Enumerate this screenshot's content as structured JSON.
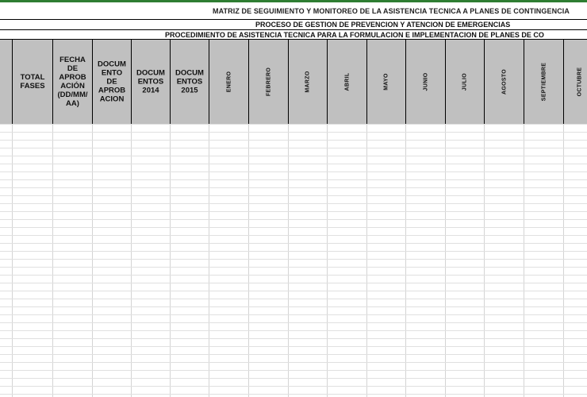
{
  "sheet": {
    "title": "MATRIZ DE SEGUIMIENTO Y MONITOREO DE LA ASISTENCIA TECNICA A PLANES DE CONTINGENCIA",
    "subtitle1": "PROCESO DE GESTION DE PREVENCION Y ATENCION DE EMERGENCIAS",
    "subtitle2": "PROCEDIMIENTO DE ASISTENCIA TECNICA PARA LA FORMULACION E IMPLEMENTACION DE PLANES DE CO"
  },
  "columns": [
    {
      "label": ""
    },
    {
      "label": "TOTAL\nFASES"
    },
    {
      "label": "FECHA\nDE\nAPROB\nACIÓN\n(DD/MM/\nAA)"
    },
    {
      "label": "DOCUM\nENTO\nDE\nAPROB\nACION"
    },
    {
      "label": "DOCUM\nENTOS\n2014"
    },
    {
      "label": "DOCUM\nENTOS\n2015"
    },
    {
      "label": "ENERO"
    },
    {
      "label": "FEBRERO"
    },
    {
      "label": "MARZO"
    },
    {
      "label": "ABRIL"
    },
    {
      "label": "MAYO"
    },
    {
      "label": "JUNIO"
    },
    {
      "label": "JULIO"
    },
    {
      "label": "AGOSTO"
    },
    {
      "label": "SEPTIEMBRE"
    },
    {
      "label": "OCTUBRE"
    }
  ],
  "colors": {
    "header_fill": "#c0c0c0",
    "accent_line": "#2e7d32",
    "gridline": "#d4d4d4"
  }
}
